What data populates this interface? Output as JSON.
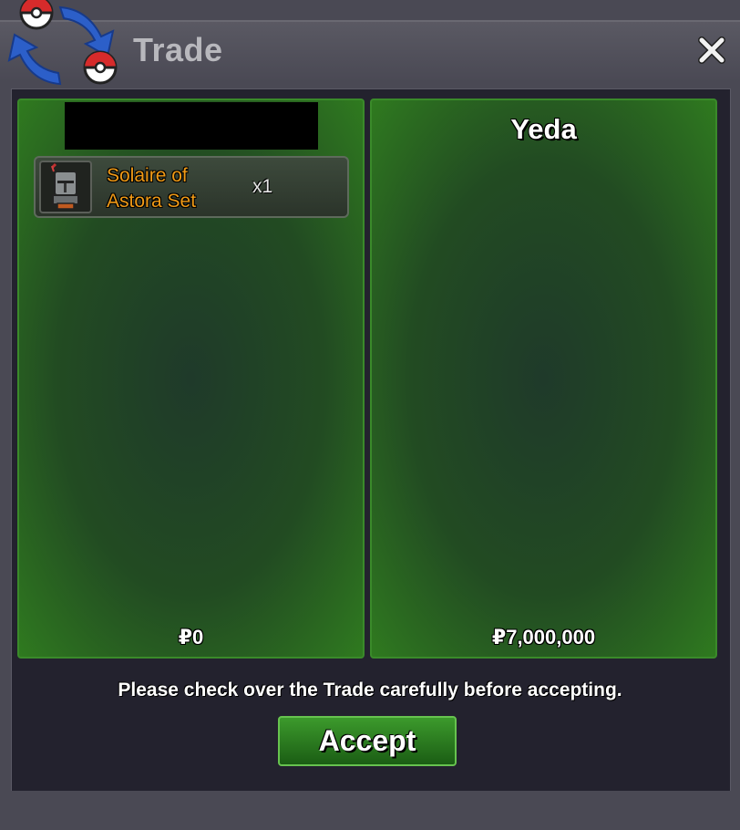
{
  "window": {
    "title": "Trade",
    "icons": {
      "logo": "trade-pokeball-icon",
      "close": "close-icon"
    }
  },
  "left_offer": {
    "items": [
      {
        "name": "Solaire of Astora Set",
        "quantity": "x1",
        "icon": "helmet-icon"
      }
    ],
    "money": "₽0"
  },
  "right_offer": {
    "name": "Yeda",
    "money": "₽7,000,000"
  },
  "notice": "Please check over the Trade carefully before accepting.",
  "accept_label": "Accept",
  "colors": {
    "item_name": "#f09a16",
    "panel_green": "#2f7a1f",
    "accept_green": "#3c9a2c"
  }
}
